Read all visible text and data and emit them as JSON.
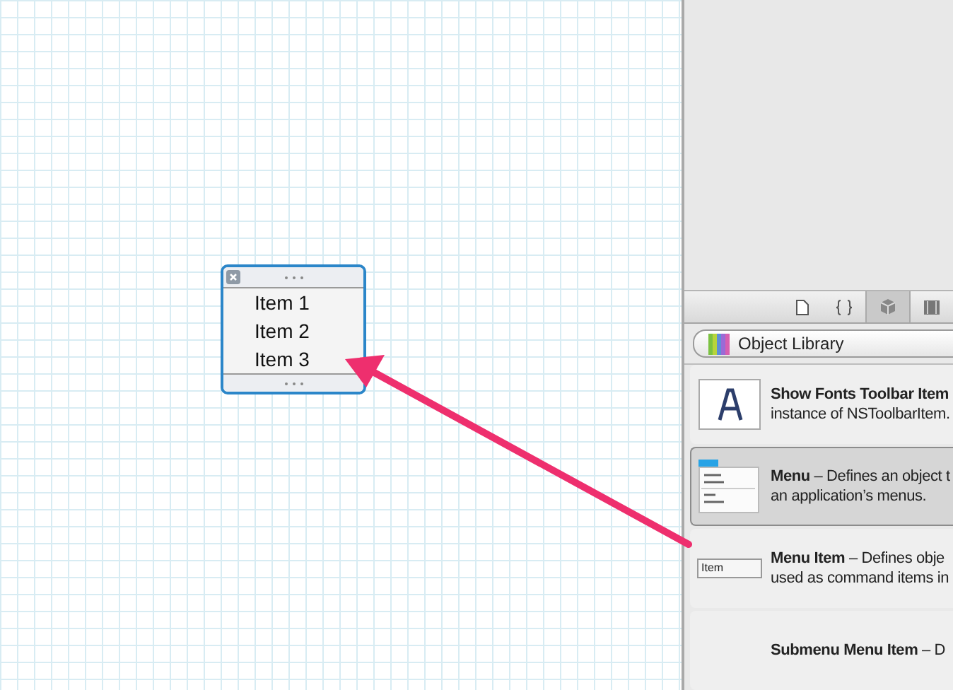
{
  "canvas": {
    "menu": {
      "items": [
        {
          "label": "Item 1"
        },
        {
          "label": "Item 2"
        },
        {
          "label": "Item 3"
        }
      ]
    }
  },
  "library": {
    "popup": {
      "label": "Object Library"
    },
    "objects": [
      {
        "kind": "font",
        "title": "Show Fonts Toolbar Item",
        "description": "instance of NSToolbarItem.",
        "selected": false
      },
      {
        "kind": "menu",
        "title": "Menu",
        "description": "– Defines an object t\nan application’s menus.",
        "selected": true
      },
      {
        "kind": "menuitem",
        "preview": "Item",
        "title": "Menu Item",
        "description": "– Defines obje\nused as command items in",
        "selected": false
      },
      {
        "kind": "submenu",
        "title": "Submenu Menu Item",
        "description": "– D",
        "selected": false
      }
    ]
  }
}
